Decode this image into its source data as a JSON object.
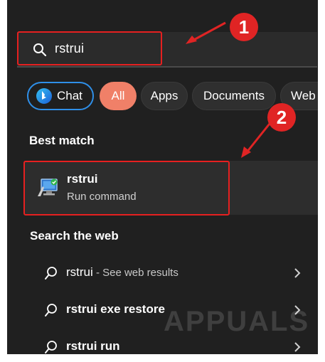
{
  "search": {
    "query": "rstrui"
  },
  "chips": {
    "chat": "Chat",
    "all": "All",
    "apps": "Apps",
    "documents": "Documents",
    "web": "Web"
  },
  "best_match": {
    "title": "Best match",
    "app_name": "rstrui",
    "app_type": "Run command"
  },
  "search_web": {
    "title": "Search the web",
    "results": [
      {
        "query": "rstrui",
        "suffix": " - See web results"
      },
      {
        "query": "rstrui exe restore",
        "suffix": ""
      },
      {
        "query": "rstrui run",
        "suffix": ""
      }
    ]
  },
  "annotations": {
    "step1": "1",
    "step2": "2"
  },
  "watermark": "APPUALS",
  "colors": {
    "panel_bg": "#202020",
    "highlight_red": "#e62020",
    "chat_border": "#2f8fe8",
    "all_chip": "#f08068"
  }
}
